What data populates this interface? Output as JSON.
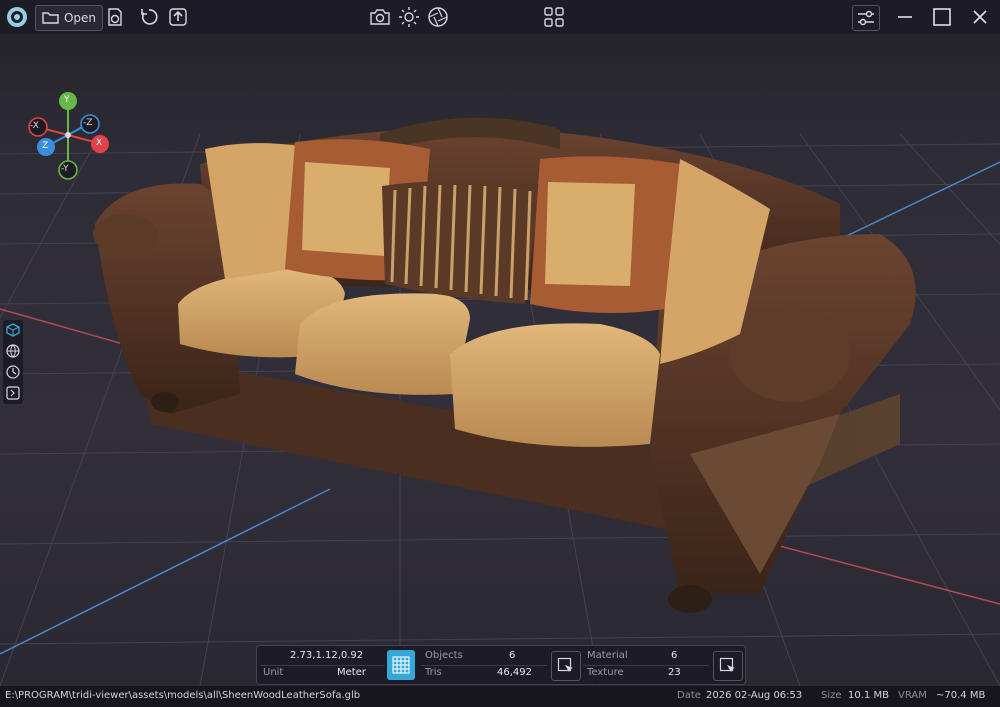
{
  "toolbar": {
    "open_label": "Open"
  },
  "gizmo": {
    "y": "Y",
    "neg_y": "-Y",
    "x": "X",
    "neg_x": "-X",
    "z": "Z",
    "neg_z": "-Z"
  },
  "info": {
    "dimensions": "2.73,1.12,0.92",
    "unit_label": "Unit",
    "unit_value": "Meter",
    "objects_label": "Objects",
    "objects_value": "6",
    "tris_label": "Tris",
    "tris_value": "46,492",
    "material_label": "Material",
    "material_value": "6",
    "texture_label": "Texture",
    "texture_value": "23"
  },
  "status": {
    "path": "E:\\PROGRAM\\tridi-viewer\\assets\\models\\all\\SheenWoodLeatherSofa.glb",
    "date_label": "Date",
    "date_value": "2026 02-Aug 06:53",
    "size_label": "Size",
    "size_value": "10.1 MB",
    "vram_label": "VRAM",
    "vram_value": "~70.4 MB"
  },
  "colors": {
    "accent": "#36a8d8",
    "axis_x": "#e0424a",
    "axis_y": "#66b84a",
    "axis_z": "#3a8ee0"
  },
  "icons": [
    "app-logo-icon",
    "folder-open-icon",
    "reload-model-icon",
    "reset-icon",
    "export-icon",
    "screenshot-icon",
    "lighting-icon",
    "aperture-icon",
    "layout-grid-icon",
    "settings-icon",
    "minimize-icon",
    "maximize-icon",
    "close-icon",
    "cube-view-icon",
    "globe-icon",
    "timer-icon",
    "panel-icon",
    "grid-toggle-icon",
    "select-cursor-icon"
  ]
}
